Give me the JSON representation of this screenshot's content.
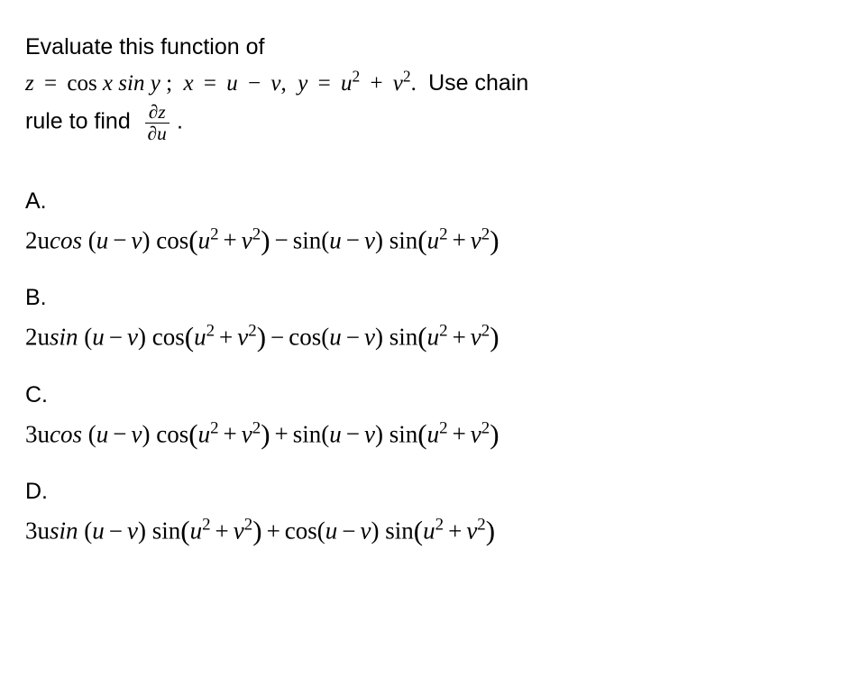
{
  "question": {
    "line1": "Evaluate this function of",
    "z_eq": "z",
    "eq1": "=",
    "cos": "cos",
    "x1": "x",
    "sin": "sin",
    "y1": "y",
    "semi": ";",
    "x2": "x",
    "eq2": "=",
    "u1": "u",
    "minus": "−",
    "v1": "v",
    "comma": ",",
    "y2": "y",
    "eq3": "=",
    "u2": "u",
    "sup2a": "2",
    "plus": "+",
    "v2": "v",
    "sup2b": "2",
    "period": ".",
    "use_chain": "Use chain",
    "rule_to_find": "rule to find",
    "dz": "∂z",
    "du": "∂u",
    "period2": "."
  },
  "options": {
    "A": {
      "label": "A.",
      "coef": "2u",
      "fn1": "cos",
      "arg1a": "u",
      "arg1b": "v",
      "fn2": "cos",
      "arg2a": "u",
      "arg2b": "v",
      "mid_op": "−",
      "fn3": "sin",
      "arg3a": "u",
      "arg3b": "v",
      "fn4": "sin",
      "arg4a": "u",
      "arg4b": "v"
    },
    "B": {
      "label": "B.",
      "coef": "2u",
      "fn1": "sin",
      "arg1a": "u",
      "arg1b": "v",
      "fn2": "cos",
      "arg2a": "u",
      "arg2b": "v",
      "mid_op": "−",
      "fn3": "cos",
      "arg3a": "u",
      "arg3b": "v",
      "fn4": "sin",
      "arg4a": "u",
      "arg4b": "v"
    },
    "C": {
      "label": "C.",
      "coef": "3u",
      "fn1": "cos",
      "arg1a": "u",
      "arg1b": "v",
      "fn2": "cos",
      "arg2a": "u",
      "arg2b": "v",
      "mid_op": "+",
      "fn3": "sin",
      "arg3a": "u",
      "arg3b": "v",
      "fn4": "sin",
      "arg4a": "u",
      "arg4b": "v"
    },
    "D": {
      "label": "D.",
      "coef": "3u",
      "fn1": "sin",
      "arg1a": "u",
      "arg1b": "v",
      "fn2": "sin",
      "arg2a": "u",
      "arg2b": "v",
      "mid_op": "+",
      "fn3": "cos",
      "arg3a": "u",
      "arg3b": "v",
      "fn4": "sin",
      "arg4a": "u",
      "arg4b": "v"
    }
  },
  "sym": {
    "minus": "−",
    "plus": "+",
    "sup2": "2"
  }
}
